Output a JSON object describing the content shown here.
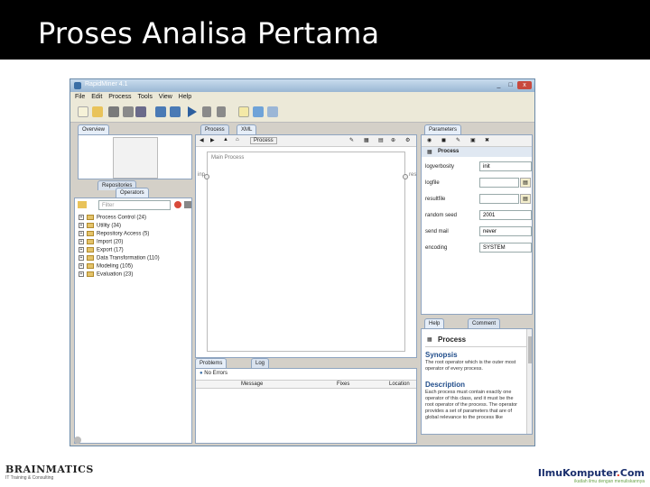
{
  "slide": {
    "title": "Proses Analisa Pertama"
  },
  "window": {
    "title": "RapidMiner 4.1",
    "controls": [
      "_",
      "□",
      "x"
    ]
  },
  "menu": [
    "File",
    "Edit",
    "Process",
    "Tools",
    "View",
    "Help"
  ],
  "overview_panel": {
    "tab": "Overview"
  },
  "left_tabs": {
    "repositories": "Repositories",
    "operators": "Operators"
  },
  "operators": {
    "search_placeholder": "Filter",
    "tree": [
      "Process Control (24)",
      "Utility (34)",
      "Repository Access (5)",
      "Import (20)",
      "Export (17)",
      "Data Transformation (110)",
      "Modeling (105)",
      "Evaluation (23)"
    ]
  },
  "center_tabs": {
    "process": "Process",
    "xml": "XML"
  },
  "process_bar": {
    "path": "Process"
  },
  "canvas": {
    "label": "Main Process",
    "in_port": "inp",
    "out_port": "res"
  },
  "bottom_tabs": {
    "problems": "Problems",
    "log": "Log"
  },
  "problems": {
    "status": "No Errors",
    "columns": [
      "Message",
      "Fixes",
      "Location"
    ]
  },
  "parameters": {
    "tab": "Parameters",
    "header": "Process",
    "rows": [
      {
        "label": "logverbosity",
        "value": "init",
        "kind": "select"
      },
      {
        "label": "logfile",
        "value": "",
        "kind": "file"
      },
      {
        "label": "resultfile",
        "value": "",
        "kind": "file"
      },
      {
        "label": "random seed",
        "value": "2001",
        "kind": "text"
      },
      {
        "label": "send mail",
        "value": "never",
        "kind": "select"
      },
      {
        "label": "encoding",
        "value": "SYSTEM",
        "kind": "select"
      }
    ]
  },
  "help": {
    "tab_help": "Help",
    "tab_comment": "Comment",
    "title": "Process",
    "synopsis_heading": "Synopsis",
    "synopsis": "The root operator which is the outer most operator of every process.",
    "description_heading": "Description",
    "description": "Each process must contain exactly one operator of this class, and it must be the root operator of the process. The operator provides a set of parameters that are of global relevance to the process like"
  },
  "footer": {
    "left_logo": "BRAINMATICS",
    "left_sub": "IT Training & Consulting",
    "right_logo_main": "IlmuKomputer",
    "right_logo_dot": ".",
    "right_logo_tld": "Com",
    "right_tagline": "ikatlah ilmu dengan menuliskannya"
  },
  "colors": {
    "header_bg": "#000000",
    "accent": "#3a6ea5"
  }
}
